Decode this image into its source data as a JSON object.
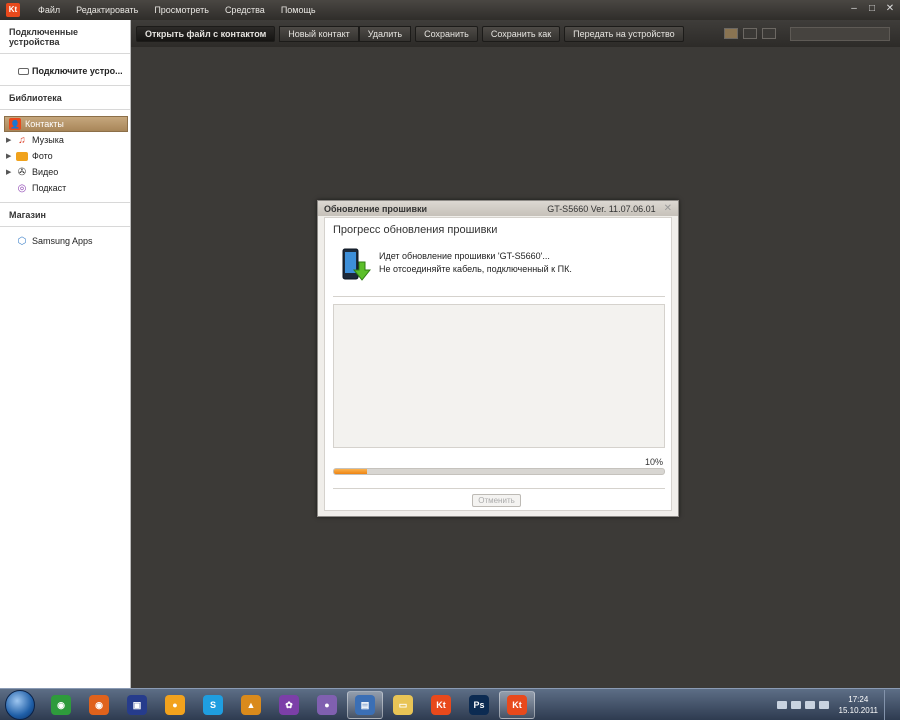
{
  "menubar": {
    "logo": "Kt",
    "items": [
      "Файл",
      "Редактировать",
      "Просмотреть",
      "Средства",
      "Помощь"
    ],
    "win_controls": [
      "–",
      "□",
      "✕"
    ]
  },
  "sidebar": {
    "connected_header": "Подключенные устройства",
    "connect_device": "Подключите устро...",
    "library_header": "Библиотека",
    "library_items": [
      {
        "label": "Контакты",
        "icon": "contacts-icon",
        "active": true
      },
      {
        "label": "Музыка",
        "icon": "music-icon",
        "active": false
      },
      {
        "label": "Фото",
        "icon": "photo-icon",
        "active": false
      },
      {
        "label": "Видео",
        "icon": "video-icon",
        "active": false
      },
      {
        "label": "Подкаст",
        "icon": "podcast-icon",
        "active": false
      }
    ],
    "store_header": "Магазин",
    "store_items": [
      {
        "label": "Samsung Apps",
        "icon": "samsung-apps-icon"
      }
    ]
  },
  "toolbar": {
    "open_contact_file": "Открыть файл с контактом",
    "new_contact": "Новый контакт",
    "delete": "Удалить",
    "save": "Сохранить",
    "save_as": "Сохранить как",
    "send_to_device": "Передать на устройство",
    "search_placeholder": ""
  },
  "dialog": {
    "title": "Обновление прошивки",
    "version": "GT-S5660 Ver. 11.07.06.01",
    "heading": "Прогресс обновления прошивки",
    "message1": "Идет обновление прошивки 'GT-S5660'...",
    "message2": "Не отсоединяйте кабель, подключенный к ПК.",
    "percent_label": "10%",
    "progress": 0.1,
    "cancel": "Отменить"
  },
  "taskbar": {
    "apps": [
      {
        "name": "chrome",
        "color": "#2e9b3c",
        "glyph": "◉"
      },
      {
        "name": "firefox",
        "color": "#e0621c",
        "glyph": "◉"
      },
      {
        "name": "floppy",
        "color": "#263c8c",
        "glyph": "▣"
      },
      {
        "name": "messenger",
        "color": "#f2a21d",
        "glyph": "●"
      },
      {
        "name": "skype",
        "color": "#1f9ee0",
        "glyph": "S"
      },
      {
        "name": "aimp",
        "color": "#d98a1c",
        "glyph": "▲"
      },
      {
        "name": "picasa",
        "color": "#7c3fa8",
        "glyph": "✿"
      },
      {
        "name": "pidgin",
        "color": "#8060b0",
        "glyph": "●"
      },
      {
        "name": "notepad",
        "color": "#3b6fb5",
        "glyph": "▤"
      },
      {
        "name": "explorer",
        "color": "#e8c456",
        "glyph": "▭"
      },
      {
        "name": "kies",
        "color": "#e8491c",
        "glyph": "Kt"
      },
      {
        "name": "photoshop",
        "color": "#0c2b52",
        "glyph": "Ps"
      },
      {
        "name": "kies-active",
        "color": "#e8491c",
        "glyph": "Kt"
      }
    ],
    "time": "17:24",
    "date": "15.10.2011"
  }
}
